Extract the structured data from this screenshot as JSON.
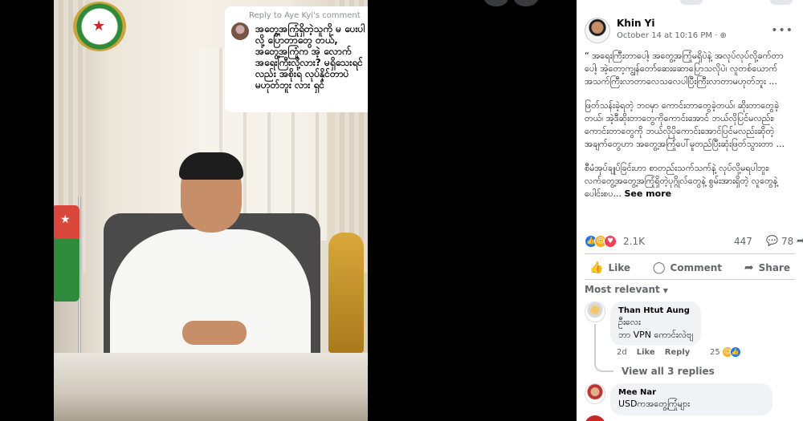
{
  "video": {
    "reply_to": "Reply to Aye Kyi's comment",
    "comment_text": "အတွေ့အကြုံရှိတဲ့သူကို မ ပေးပါလို့ ပြောတာတွေ တယ်, အတွေ့အကြုံက အဲ့ လောက်အရေးကြီးလို့လား? မရှိသေးရင်လည်း အစိုးရ လုပ်နိုင်တာပဲ မဟုတ်ဘူး လား ရှင်"
  },
  "post": {
    "author": "Khin Yi",
    "date": "October 14 at 10:16 PM · ",
    "paragraphs": [
      "“ အရေးကြီးတာပေါ့၊ အတွေ့အကြုံမရှိပဲနဲ့ အလုပ်လုပ်လို့ခက်တာပေါ့၊ အဲ့တော့ကျွန်တော်ဆေးဆောပြောသလိုပဲ၊ လူတစ်ယောက်အသက်ကြီးလာတာလေသလေပါပြီးကြီးလာတာမဟုတ်ဘူး ...",
      "ဖြတ်သန်းခဲ့ရတဲ့ ဘဝမှာ ကောင်းတာတွေခဲ့တယ်၊ ဆိုးတာတွေခဲ့တယ်၊ အဲ့ဒီဆိုးတာတွေကိုကောင်းအောင် ဘယ်လိုပြင်မလည်း၊ ကောင်းတာတွေကို ဘယ်လိုပိုကောင်းအောင်ပြင်မလည်းဆိုတဲ့အချက်တွေဟာ အတွေ့အကြုံပေါ်မူတည်ပြီးဆုံးဖြတ်သွားတာ ...",
      "စီမံအုပ်ချုပ်ခြင်းဟာ စာတည်းသက်သက်နဲ့ လုပ်လို့မရပါဘူး၊ လက်တွေ့အတွေ့အကြုံရှိတဲ့ပုဂ္ဂိုလ်တွေနဲ့ စွမ်းအားရှိတဲ့ လူတွေနဲ့ပေါင်းစပ..."
    ],
    "see_more": "See more",
    "reaction_count": "2.1K",
    "comment_count": "447",
    "share_count": "78",
    "actions": {
      "like": "Like",
      "comment": "Comment",
      "share": "Share"
    },
    "sort_label": "Most relevant"
  },
  "comments": [
    {
      "name": "Than Htut Aung",
      "lines": [
        "ဦးလေး",
        "ဘာ VPN ကောင်းလဲဗျ"
      ],
      "time": "2d",
      "like": "Like",
      "reply": "Reply",
      "reactions": "25",
      "view_replies": "View all 3 replies"
    },
    {
      "name": "Mee Nar",
      "lines": [
        "USDကအတွေ့ကြုံများ"
      ]
    }
  ],
  "icons": {
    "globe": "globe-icon",
    "like": "thumbs-up-icon",
    "comment": "speech-bubble-icon",
    "share": "share-arrow-icon"
  }
}
